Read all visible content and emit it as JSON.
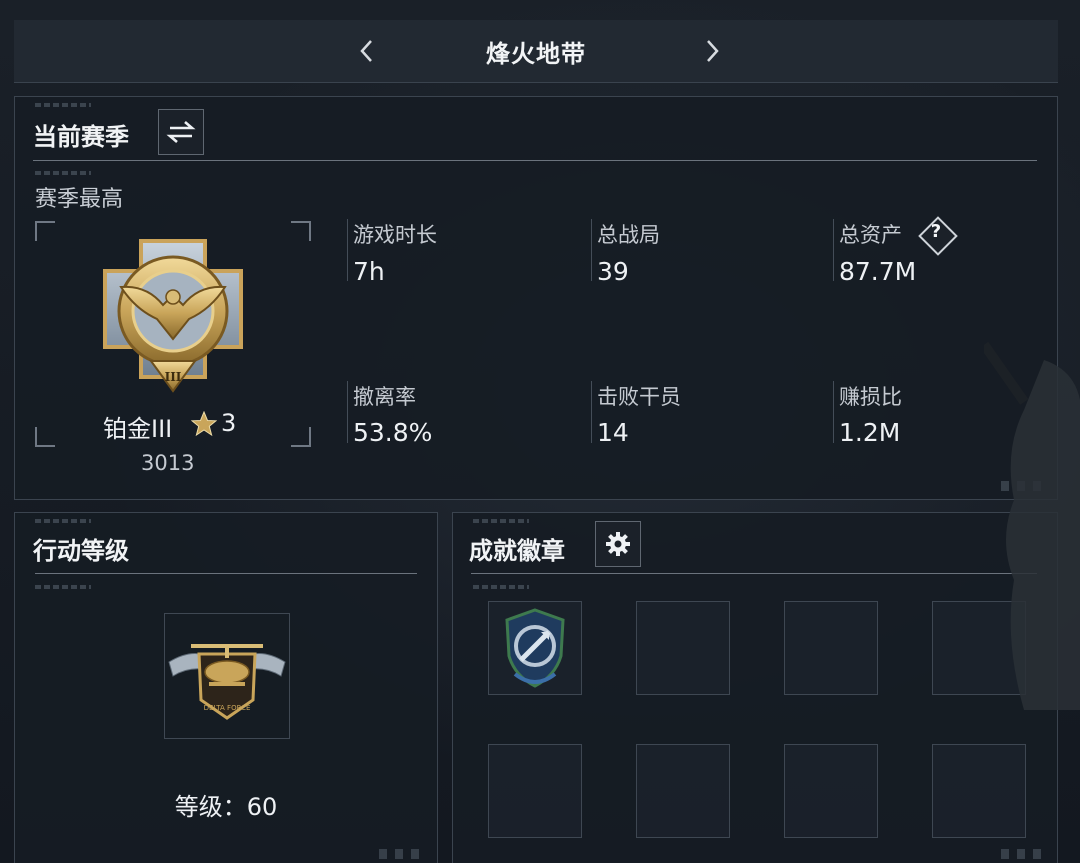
{
  "header": {
    "title": "烽火地带"
  },
  "season": {
    "title": "当前赛季",
    "subtitle": "赛季最高",
    "rank": {
      "name": "铂金III",
      "stars": "3",
      "score": "3013",
      "tier_numeral": "III"
    },
    "stats": [
      {
        "label": "游戏时长",
        "value": "7h"
      },
      {
        "label": "总战局",
        "value": "39"
      },
      {
        "label": "总资产",
        "value": "87.7M"
      },
      {
        "label": "撤离率",
        "value": "53.8%"
      },
      {
        "label": "击败干员",
        "value": "14"
      },
      {
        "label": "赚损比",
        "value": "1.2M"
      }
    ]
  },
  "level": {
    "title": "行动等级",
    "label": "等级：60"
  },
  "achievements": {
    "title": "成就徽章"
  },
  "colors": {
    "accent_gold": "#c9a55a",
    "panel_bg": "#161c24",
    "border": "#3b444f",
    "badge_blue": "#3b6fa8",
    "badge_green": "#3e7a4e"
  },
  "icons": {
    "swap": "swap-icon",
    "settings": "gear-icon",
    "help": "help-icon",
    "prev": "chevron-left-icon",
    "next": "chevron-right-icon"
  }
}
